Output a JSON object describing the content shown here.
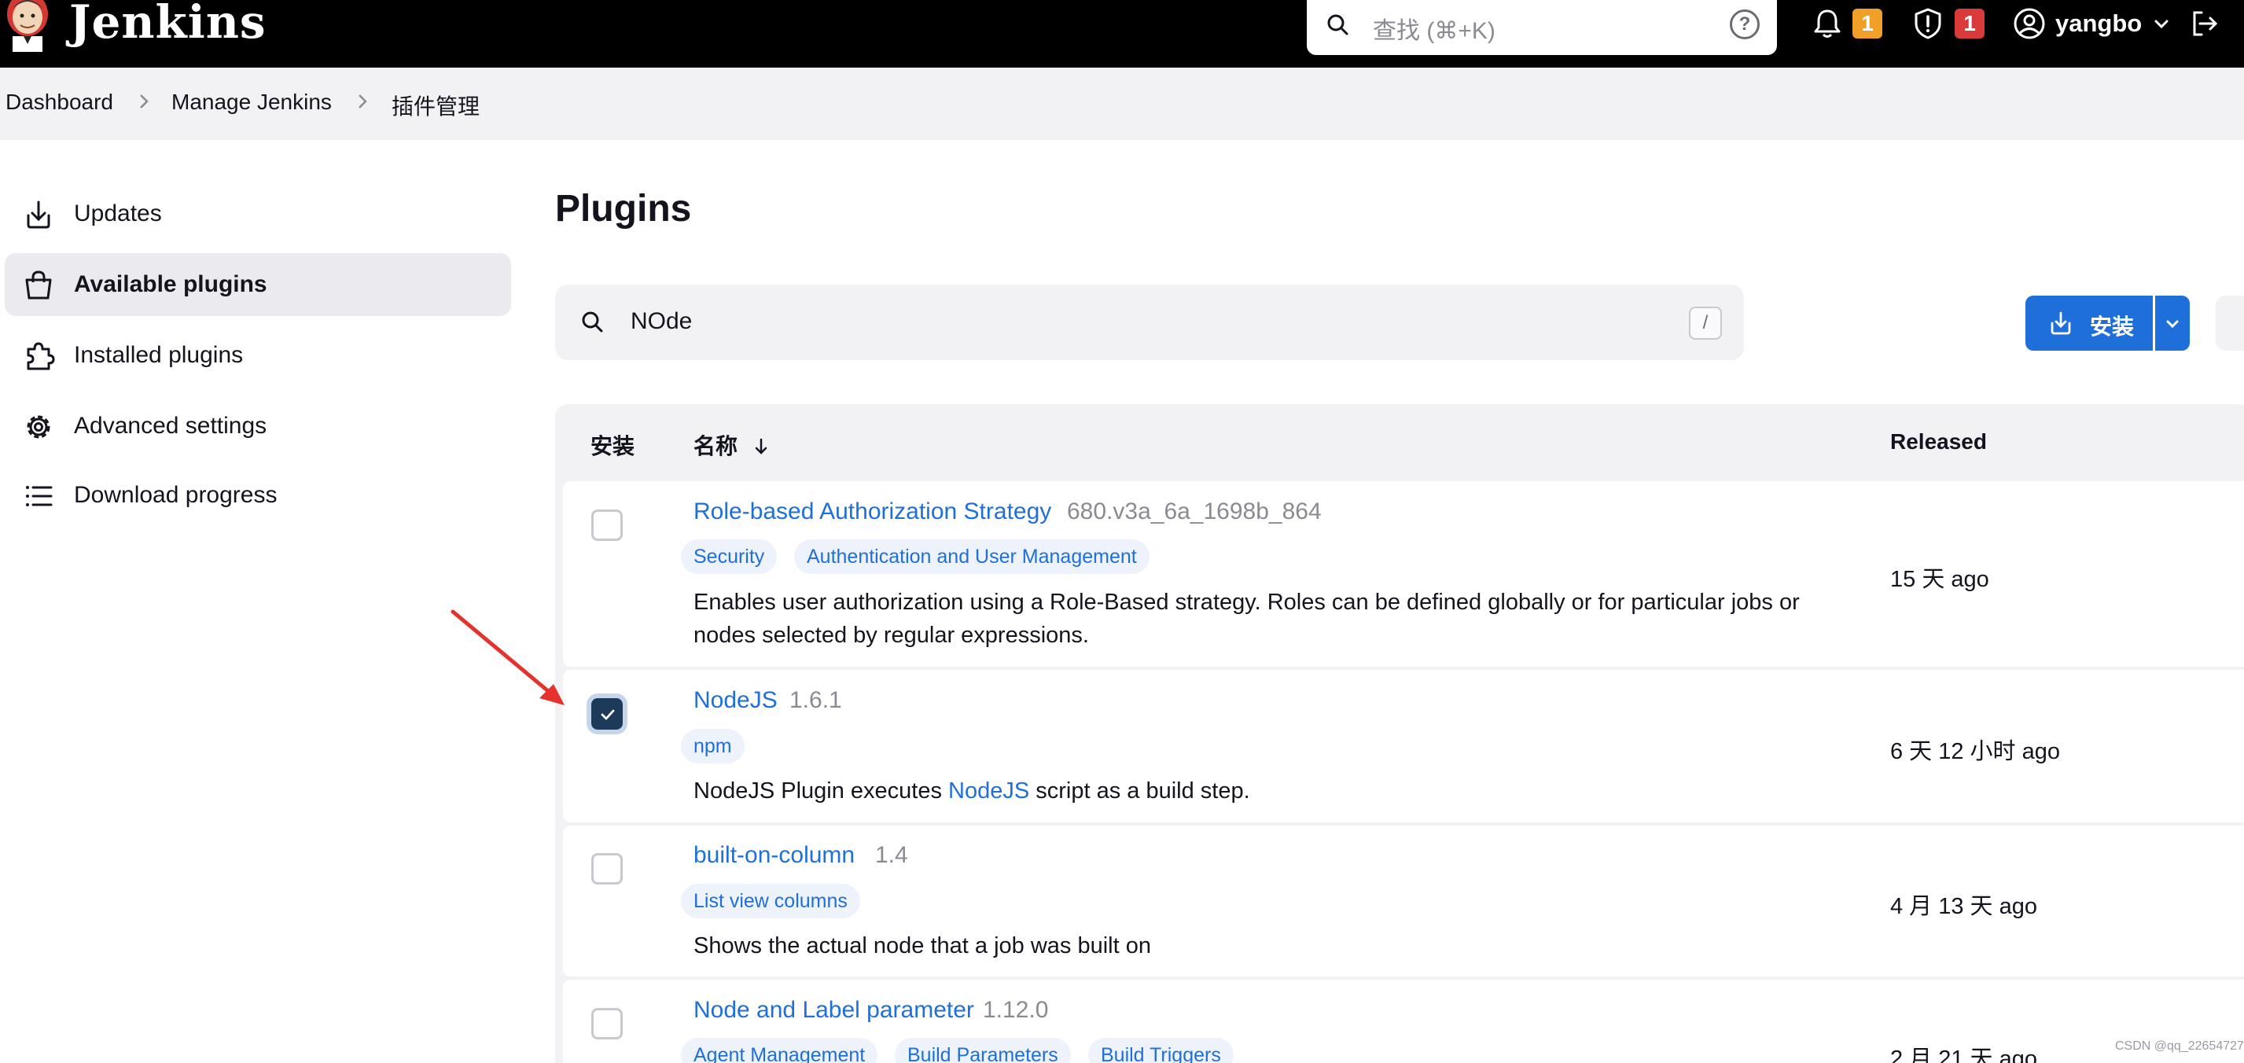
{
  "header": {
    "app_name": "Jenkins",
    "search_placeholder": "查找 (⌘+K)",
    "help_glyph": "?",
    "notifications_count": "1",
    "security_count": "1",
    "user_name": "yangbo",
    "colors": {
      "bar": "#000000",
      "notify_badge": "#f0a028",
      "security_badge": "#d93a3a"
    }
  },
  "breadcrumb": [
    "Dashboard",
    "Manage Jenkins",
    "插件管理"
  ],
  "sidebar": {
    "items": [
      {
        "label": "Updates",
        "icon": "download-icon",
        "active": false
      },
      {
        "label": "Available plugins",
        "icon": "shopping-bag-icon",
        "active": true
      },
      {
        "label": "Installed plugins",
        "icon": "puzzle-icon",
        "active": false
      },
      {
        "label": "Advanced settings",
        "icon": "gear-icon",
        "active": false
      },
      {
        "label": "Download progress",
        "icon": "list-icon",
        "active": false
      }
    ]
  },
  "main": {
    "title": "Plugins",
    "filter_value": "NOde",
    "filter_shortcut": "/",
    "install_label": "安装"
  },
  "table": {
    "headers": {
      "install": "安装",
      "name": "名称",
      "released": "Released"
    },
    "rows": [
      {
        "name": "Role-based Authorization Strategy",
        "version": "680.v3a_6a_1698b_864",
        "tags": [
          "Security",
          "Authentication and User Management"
        ],
        "description_line1": "Enables user authorization using a Role-Based strategy. Roles can be defined globally or for particular jobs or",
        "description_line2": "nodes selected by regular expressions.",
        "released": "15 天 ago",
        "checked": false
      },
      {
        "name": "NodeJS",
        "version": "1.6.1",
        "tags": [
          "npm"
        ],
        "description_pre": "NodeJS Plugin executes ",
        "description_link": "NodeJS",
        "description_post": " script as a build step.",
        "released": "6 天 12 小时 ago",
        "checked": true
      },
      {
        "name": "built-on-column",
        "version": "1.4",
        "tags": [
          "List view columns"
        ],
        "description_line1": "Shows the actual node that a job was built on",
        "released": "4 月 13 天 ago",
        "checked": false
      },
      {
        "name": "Node and Label parameter",
        "version": "1.12.0",
        "tags": [
          "Agent Management",
          "Build Parameters",
          "Build Triggers"
        ],
        "released": "2 月 21 天 ago",
        "checked": false
      }
    ]
  },
  "watermark": "CSDN @qq_22654727"
}
